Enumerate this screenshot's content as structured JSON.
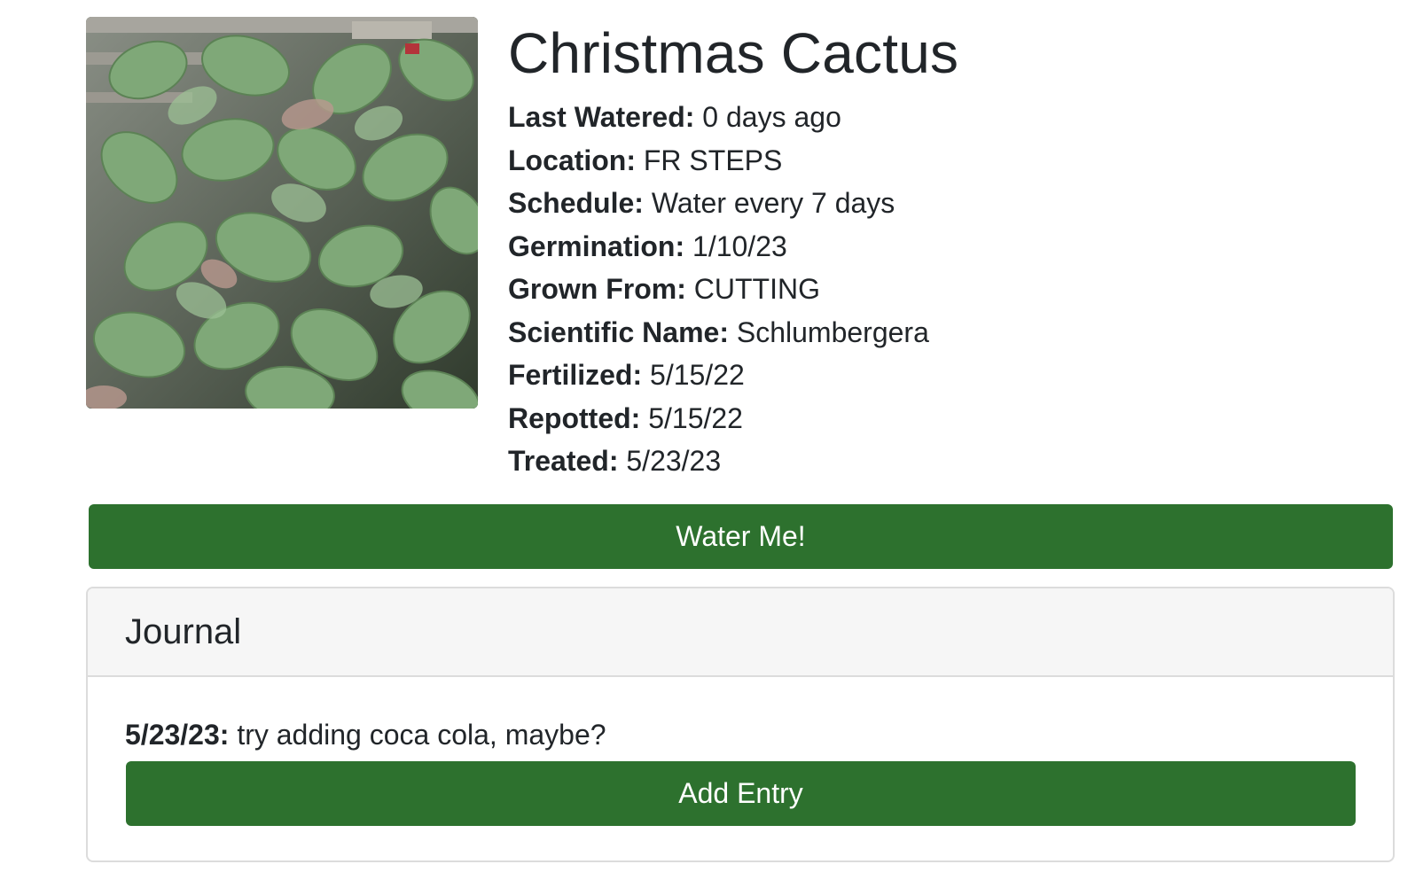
{
  "plant": {
    "name": "Christmas Cactus",
    "photo_alt": "plant-photo"
  },
  "details": [
    {
      "label": "Last Watered:",
      "value": "0 days ago"
    },
    {
      "label": "Location:",
      "value": "FR STEPS"
    },
    {
      "label": "Schedule:",
      "value": "Water every 7 days"
    },
    {
      "label": "Germination:",
      "value": "1/10/23"
    },
    {
      "label": "Grown From:",
      "value": "CUTTING"
    },
    {
      "label": "Scientific Name:",
      "value": "Schlumbergera"
    },
    {
      "label": "Fertilized:",
      "value": "5/15/22"
    },
    {
      "label": "Repotted:",
      "value": "5/15/22"
    },
    {
      "label": "Treated:",
      "value": "5/23/23"
    }
  ],
  "actions": {
    "water_label": "Water Me!"
  },
  "journal": {
    "title": "Journal",
    "entries": [
      {
        "date": "5/23/23:",
        "text": "try adding coca cola, maybe?"
      }
    ],
    "add_label": "Add Entry"
  },
  "colors": {
    "button_green": "#2d712e",
    "card_header_bg": "#f6f6f6",
    "text": "#212529"
  }
}
